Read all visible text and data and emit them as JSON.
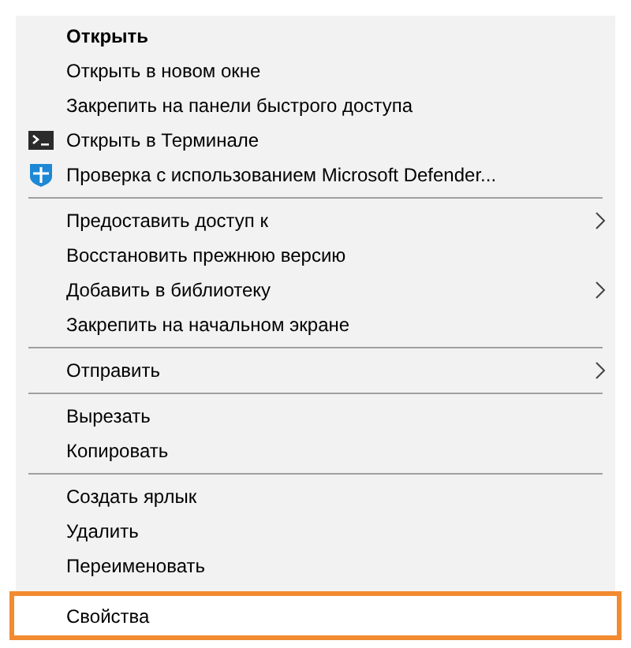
{
  "menu": {
    "items": [
      {
        "kind": "plain",
        "label": "Открыть",
        "bold": true,
        "submenu": false,
        "highlighted": false
      },
      {
        "kind": "plain",
        "label": "Открыть в новом окне",
        "bold": false,
        "submenu": false,
        "highlighted": false
      },
      {
        "kind": "plain",
        "label": "Закрепить на панели быстрого доступа",
        "bold": false,
        "submenu": false,
        "highlighted": false
      },
      {
        "kind": "terminal",
        "label": "Открыть в Терминале",
        "bold": false,
        "submenu": false,
        "highlighted": false
      },
      {
        "kind": "shield",
        "label": "Проверка с использованием Microsoft Defender...",
        "bold": false,
        "submenu": false,
        "highlighted": false
      },
      {
        "kind": "separator"
      },
      {
        "kind": "plain",
        "label": "Предоставить доступ к",
        "bold": false,
        "submenu": true,
        "highlighted": false
      },
      {
        "kind": "plain",
        "label": "Восстановить прежнюю версию",
        "bold": false,
        "submenu": false,
        "highlighted": false
      },
      {
        "kind": "plain",
        "label": "Добавить в библиотеку",
        "bold": false,
        "submenu": true,
        "highlighted": false
      },
      {
        "kind": "plain",
        "label": "Закрепить на начальном экране",
        "bold": false,
        "submenu": false,
        "highlighted": false
      },
      {
        "kind": "separator"
      },
      {
        "kind": "plain",
        "label": "Отправить",
        "bold": false,
        "submenu": true,
        "highlighted": false
      },
      {
        "kind": "separator"
      },
      {
        "kind": "plain",
        "label": "Вырезать",
        "bold": false,
        "submenu": false,
        "highlighted": false
      },
      {
        "kind": "plain",
        "label": "Копировать",
        "bold": false,
        "submenu": false,
        "highlighted": false
      },
      {
        "kind": "separator"
      },
      {
        "kind": "plain",
        "label": "Создать ярлык",
        "bold": false,
        "submenu": false,
        "highlighted": false
      },
      {
        "kind": "plain",
        "label": "Удалить",
        "bold": false,
        "submenu": false,
        "highlighted": false
      },
      {
        "kind": "plain",
        "label": "Переименовать",
        "bold": false,
        "submenu": false,
        "highlighted": false
      },
      {
        "kind": "plain",
        "label": "Свойства",
        "bold": false,
        "submenu": false,
        "highlighted": true
      }
    ]
  }
}
